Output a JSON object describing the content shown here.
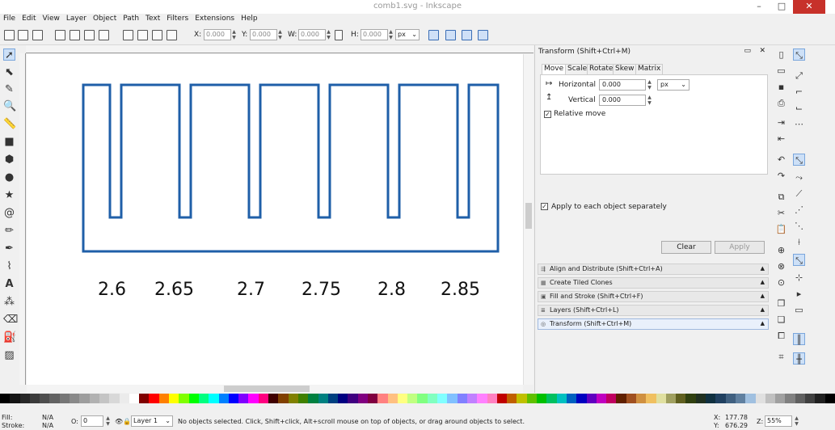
{
  "window": {
    "title": "comb1.svg - Inkscape",
    "controls": [
      "–",
      "□",
      "✕"
    ]
  },
  "menu": [
    "File",
    "Edit",
    "View",
    "Layer",
    "Object",
    "Path",
    "Text",
    "Filters",
    "Extensions",
    "Help"
  ],
  "toolbar": {
    "x_label": "X:",
    "x_value": "0.000",
    "y_label": "Y:",
    "y_value": "0.000",
    "w_label": "W:",
    "w_value": "0.000",
    "h_label": "H:",
    "h_value": "0.000",
    "unit": "px"
  },
  "canvas": {
    "comb_color": "#1f5fa8",
    "labels": [
      "2.6",
      "2.65",
      "2.7",
      "2.75",
      "2.8",
      "2.85"
    ]
  },
  "dock": {
    "title": "Transform (Shift+Ctrl+M)",
    "tabs": [
      "Move",
      "Scale",
      "Rotate",
      "Skew",
      "Matrix"
    ],
    "horizontal_label": "Horizontal",
    "horizontal_value": "0.000",
    "vertical_label": "Vertical",
    "vertical_value": "0.000",
    "unit": "px",
    "relative_move_label": "Relative move",
    "apply_each_label": "Apply to each object separately",
    "clear_label": "Clear",
    "apply_label": "Apply",
    "bars": [
      "Align and Distribute (Shift+Ctrl+A)",
      "Create Tiled Clones",
      "Fill and Stroke (Shift+Ctrl+F)",
      "Layers (Shift+Ctrl+L)",
      "Transform (Shift+Ctrl+M)"
    ]
  },
  "status": {
    "fill_label": "Fill:",
    "fill_value": "N/A",
    "stroke_label": "Stroke:",
    "stroke_value": "N/A",
    "opacity_value": "0",
    "layer": "Layer 1",
    "message": "No objects selected. Click, Shift+click, Alt+scroll mouse on top of objects, or drag around objects to select.",
    "x_label": "X:",
    "x_value": "177.78",
    "y_label": "Y:",
    "y_value": "676.29",
    "z_label": "Z:",
    "zoom": "55%"
  }
}
